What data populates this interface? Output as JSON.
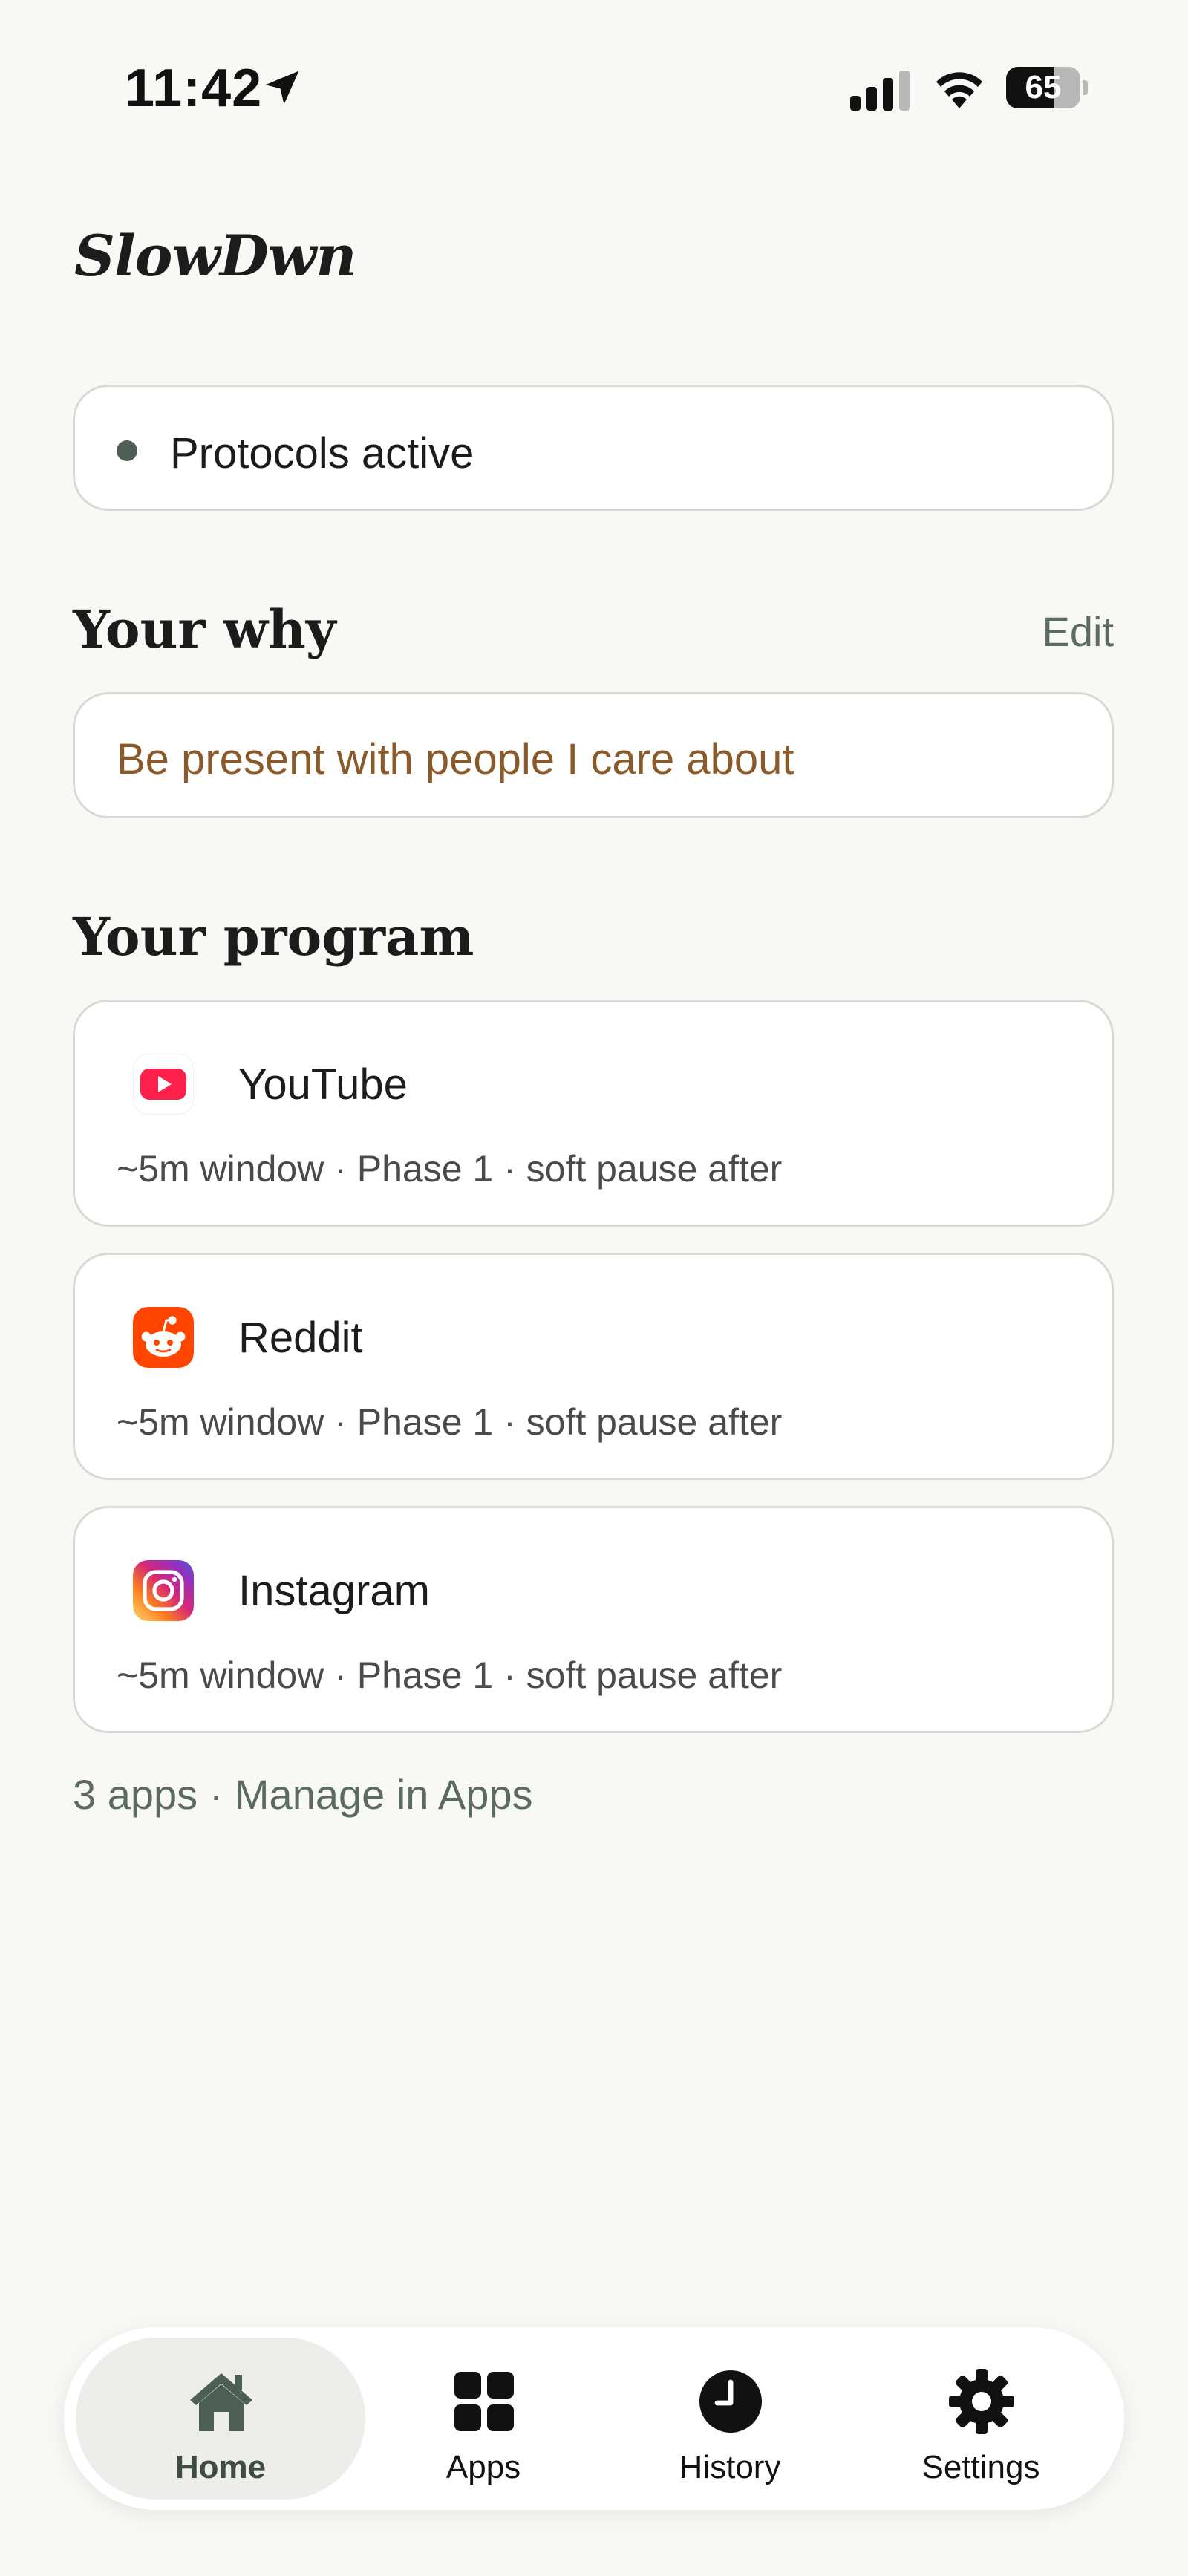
{
  "status_bar": {
    "time": "11:42",
    "battery_level": 65,
    "battery_label": "65",
    "icons": [
      "location-arrow-icon",
      "signal-icon",
      "wifi-icon",
      "battery-icon"
    ]
  },
  "app": {
    "title": "SlowDwn"
  },
  "status_card": {
    "label": "Protocols active",
    "dot_color": "#4d5e54"
  },
  "why": {
    "heading": "Your why",
    "edit_label": "Edit",
    "text": "Be present with people I care about",
    "text_color": "#8a5a2a"
  },
  "program": {
    "heading": "Your program",
    "items": [
      {
        "name": "YouTube",
        "icon": "youtube-icon",
        "detail": "~5m window · Phase 1 · soft pause after"
      },
      {
        "name": "Reddit",
        "icon": "reddit-icon",
        "detail": "~5m window · Phase 1 · soft pause after"
      },
      {
        "name": "Instagram",
        "icon": "instagram-icon",
        "detail": "~5m window · Phase 1 · soft pause after"
      }
    ],
    "summary": "3 apps · Manage in Apps"
  },
  "tab_bar": {
    "active": "Home",
    "tabs": [
      {
        "label": "Home",
        "icon": "home-icon"
      },
      {
        "label": "Apps",
        "icon": "apps-grid-icon"
      },
      {
        "label": "History",
        "icon": "clock-icon"
      },
      {
        "label": "Settings",
        "icon": "gear-icon"
      }
    ]
  },
  "colors": {
    "background": "#f8f8f5",
    "accent_green": "#4d5e54",
    "why_text": "#8a5a2a"
  }
}
